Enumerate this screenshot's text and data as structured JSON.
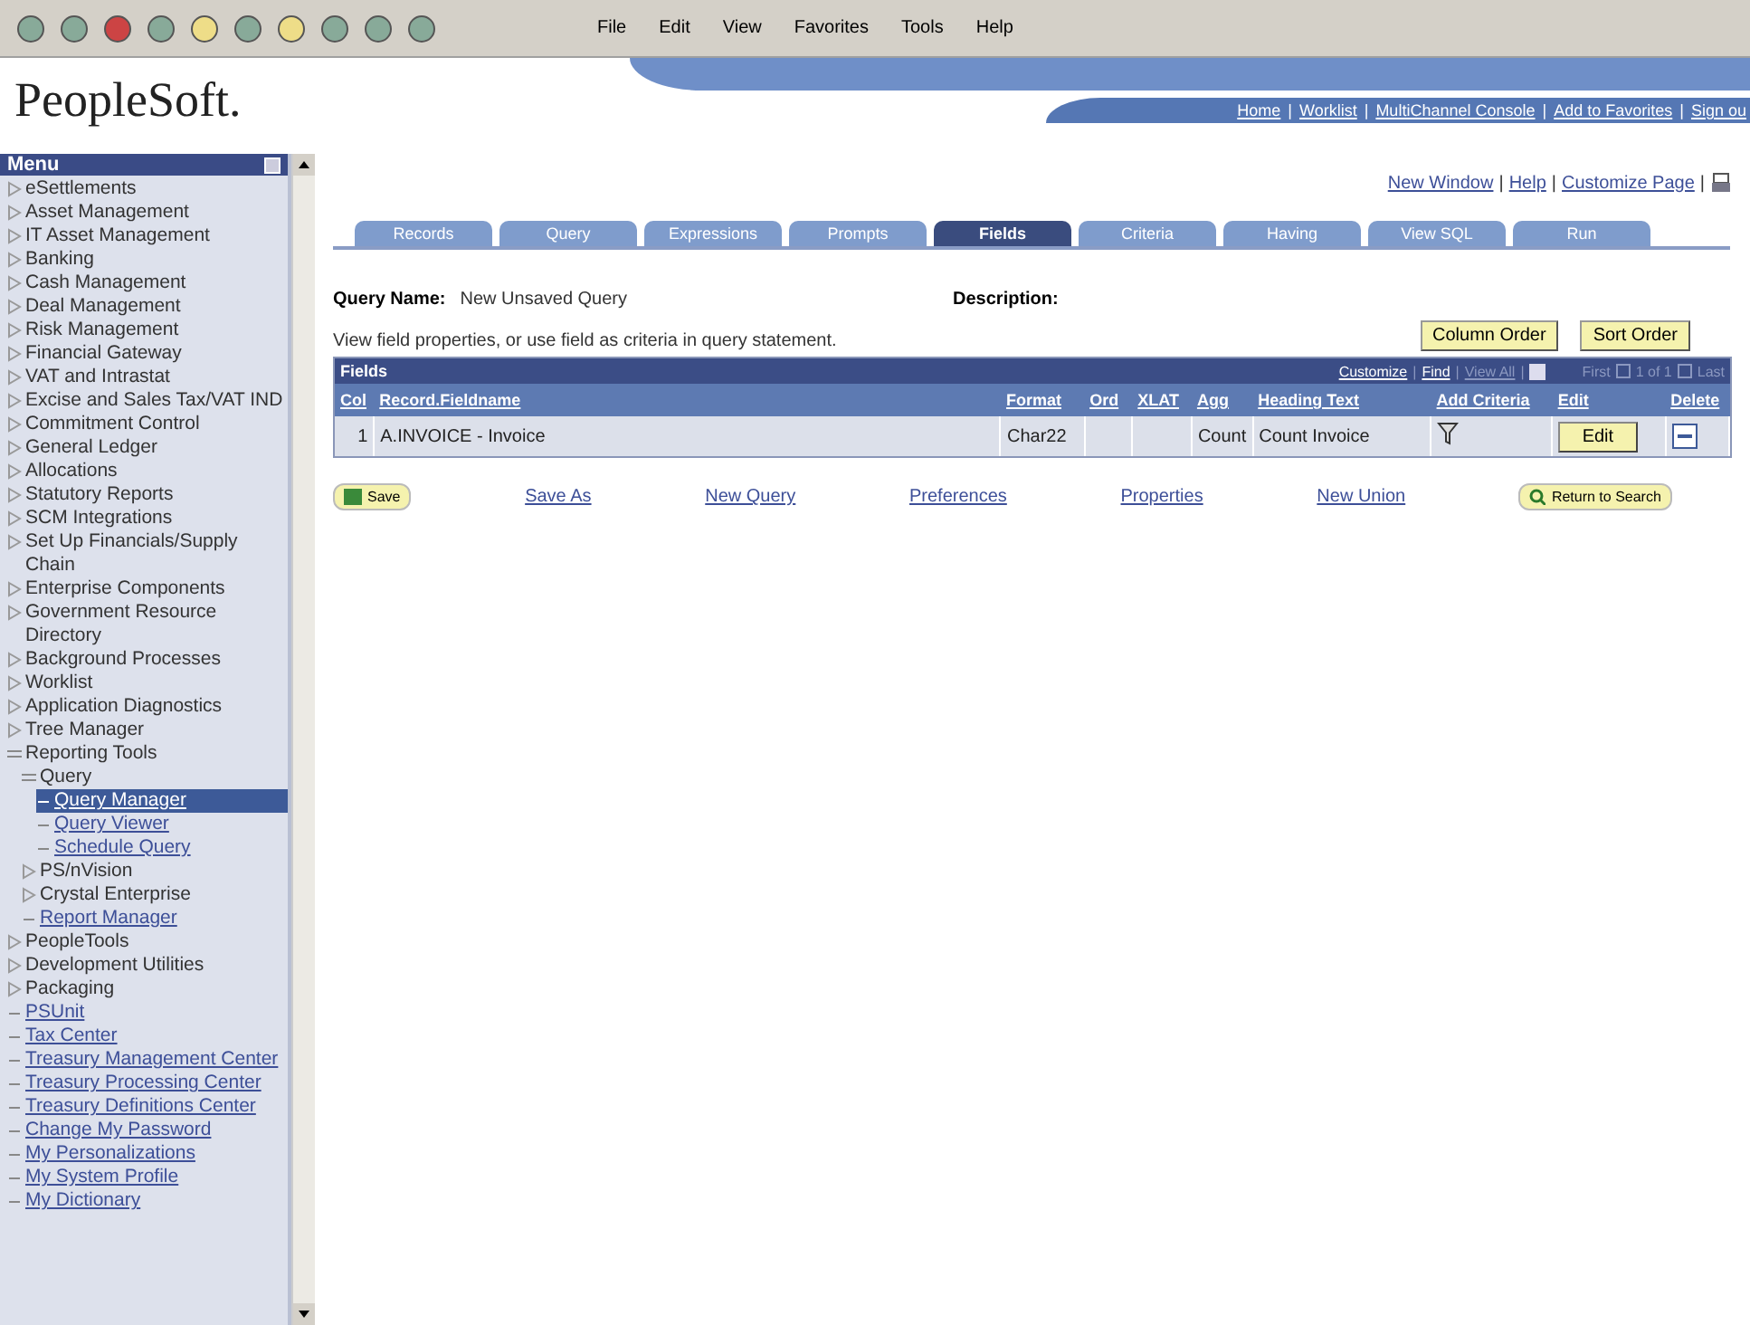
{
  "browser": {
    "menu": [
      "File",
      "Edit",
      "View",
      "Favorites",
      "Tools",
      "Help"
    ]
  },
  "header": {
    "logo": "PeopleSoft.",
    "separator": "|",
    "links": [
      "Home",
      "Worklist",
      "MultiChannel Console",
      "Add to Favorites",
      "Sign ou"
    ]
  },
  "menu": {
    "title": "Menu",
    "items": [
      {
        "label": "eSettlements",
        "kind": "folder"
      },
      {
        "label": "Asset Management",
        "kind": "folder"
      },
      {
        "label": "IT Asset Management",
        "kind": "folder"
      },
      {
        "label": "Banking",
        "kind": "folder"
      },
      {
        "label": "Cash Management",
        "kind": "folder"
      },
      {
        "label": "Deal Management",
        "kind": "folder"
      },
      {
        "label": "Risk Management",
        "kind": "folder"
      },
      {
        "label": "Financial Gateway",
        "kind": "folder"
      },
      {
        "label": "VAT and Intrastat",
        "kind": "folder"
      },
      {
        "label": "Excise and Sales Tax/VAT IND",
        "kind": "folder"
      },
      {
        "label": "Commitment Control",
        "kind": "folder"
      },
      {
        "label": "General Ledger",
        "kind": "folder"
      },
      {
        "label": "Allocations",
        "kind": "folder"
      },
      {
        "label": "Statutory Reports",
        "kind": "folder"
      },
      {
        "label": "SCM Integrations",
        "kind": "folder"
      },
      {
        "label": "Set Up Financials/Supply Chain",
        "kind": "folder"
      },
      {
        "label": "Enterprise Components",
        "kind": "folder"
      },
      {
        "label": "Government Resource Directory",
        "kind": "folder"
      },
      {
        "label": "Background Processes",
        "kind": "folder"
      },
      {
        "label": "Worklist",
        "kind": "folder"
      },
      {
        "label": "Application Diagnostics",
        "kind": "folder"
      },
      {
        "label": "Tree Manager",
        "kind": "folder"
      },
      {
        "label": "Reporting Tools",
        "kind": "folder",
        "expanded": true,
        "children": [
          {
            "label": "Query",
            "kind": "folder",
            "expanded": true,
            "children": [
              {
                "label": "Query Manager",
                "kind": "link",
                "selected": true
              },
              {
                "label": "Query Viewer",
                "kind": "link",
                "selected": false
              },
              {
                "label": "Schedule Query",
                "kind": "link",
                "selected": false
              }
            ]
          },
          {
            "label": "PS/nVision",
            "kind": "folder"
          },
          {
            "label": "Crystal Enterprise",
            "kind": "folder"
          },
          {
            "label": "Report Manager",
            "kind": "link",
            "selected": false
          }
        ]
      },
      {
        "label": "PeopleTools",
        "kind": "folder"
      },
      {
        "label": "Development Utilities",
        "kind": "folder"
      },
      {
        "label": "Packaging",
        "kind": "folder"
      },
      {
        "label": "PSUnit",
        "kind": "link",
        "selected": false
      },
      {
        "label": "Tax Center",
        "kind": "link",
        "selected": false
      },
      {
        "label": "Treasury Management Center",
        "kind": "link",
        "selected": false
      },
      {
        "label": "Treasury Processing Center",
        "kind": "link",
        "selected": false
      },
      {
        "label": "Treasury Definitions Center",
        "kind": "link",
        "selected": false
      },
      {
        "label": "Change My Password",
        "kind": "link",
        "selected": false
      },
      {
        "label": "My Personalizations",
        "kind": "link",
        "selected": false
      },
      {
        "label": "My System Profile",
        "kind": "link",
        "selected": false
      },
      {
        "label": "My Dictionary",
        "kind": "link",
        "selected": false
      }
    ]
  },
  "page_links": [
    "New Window",
    "Help",
    "Customize Page"
  ],
  "page_links_separator": "|",
  "tabs": [
    {
      "label": "Records",
      "selected": false
    },
    {
      "label": "Query",
      "selected": false
    },
    {
      "label": "Expressions",
      "selected": false
    },
    {
      "label": "Prompts",
      "selected": false
    },
    {
      "label": "Fields",
      "selected": true
    },
    {
      "label": "Criteria",
      "selected": false
    },
    {
      "label": "Having",
      "selected": false
    },
    {
      "label": "View SQL",
      "selected": false
    },
    {
      "label": "Run",
      "selected": false
    }
  ],
  "query_name": {
    "label": "Query Name:",
    "value": "New Unsaved Query"
  },
  "description": {
    "label": "Description:"
  },
  "instructions": "View field properties, or use field as criteria in query statement.",
  "order_buttons": [
    "Column Order",
    "Sort Order"
  ],
  "grid": {
    "title": "Fields",
    "separator": "|",
    "tools": [
      {
        "label": "Customize",
        "disabled": false
      },
      {
        "label": "Find",
        "disabled": false
      },
      {
        "label": "View All",
        "disabled": true
      }
    ],
    "nav": {
      "first": "First",
      "range": "1 of 1",
      "last": "Last"
    },
    "columns": [
      "Col",
      "Record.Fieldname",
      "Format",
      "Ord",
      "XLAT",
      "Agg",
      "Heading Text",
      "Add Criteria",
      "Edit",
      "Delete"
    ],
    "rows": [
      {
        "col": "1",
        "field": "A.INVOICE - Invoice",
        "format": "Char22",
        "agg": "Count",
        "heading": "Count Invoice",
        "edit": "Edit"
      }
    ]
  },
  "actions": [
    {
      "label": "Save",
      "kind": "button"
    },
    {
      "label": "Save As",
      "kind": "link"
    },
    {
      "label": "New Query",
      "kind": "link"
    },
    {
      "label": "Preferences",
      "kind": "link"
    },
    {
      "label": "Properties",
      "kind": "link"
    },
    {
      "label": "New Union",
      "kind": "link"
    },
    {
      "label": "Return to Search",
      "kind": "button"
    }
  ]
}
